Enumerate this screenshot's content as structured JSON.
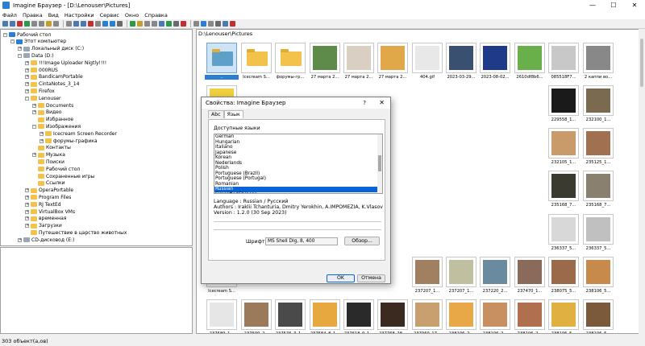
{
  "window": {
    "title": "Imagine Браузер - [D:\\Lenouser\\Pictures]",
    "buttons": [
      "—",
      "☐",
      "✕"
    ]
  },
  "menu": [
    "Файл",
    "Правка",
    "Вид",
    "Настройки",
    "Сервис",
    "Окно",
    "Справка"
  ],
  "tree": [
    {
      "label": "Рабочий стол",
      "level": 0,
      "icon": "desktop-icon",
      "exp": "–"
    },
    {
      "label": "Этот компьютер",
      "level": 1,
      "icon": "computer-icon",
      "exp": "–"
    },
    {
      "label": "Локальный диск (C:)",
      "level": 2,
      "icon": "drive-icon",
      "exp": "+"
    },
    {
      "label": "Data (D:)",
      "level": 2,
      "icon": "drive-icon",
      "exp": "–"
    },
    {
      "label": "!!!Image Uploader Nigtly!!!!",
      "level": 3,
      "icon": "folder-icon",
      "exp": "+"
    },
    {
      "label": "000RUS",
      "level": 3,
      "icon": "folder-icon",
      "exp": "+"
    },
    {
      "label": "BandicamPortable",
      "level": 3,
      "icon": "folder-icon",
      "exp": "+"
    },
    {
      "label": "CintaNotes_3_14",
      "level": 3,
      "icon": "folder-icon",
      "exp": "+"
    },
    {
      "label": "Firefox",
      "level": 3,
      "icon": "folder-icon",
      "exp": "+"
    },
    {
      "label": "Lenouser",
      "level": 3,
      "icon": "folder-icon",
      "exp": "–"
    },
    {
      "label": "Documents",
      "level": 4,
      "icon": "folder-icon",
      "exp": "+"
    },
    {
      "label": "Видео",
      "level": 4,
      "icon": "folder-icon",
      "exp": "+"
    },
    {
      "label": "Избранное",
      "level": 4,
      "icon": "folder-icon",
      "exp": ""
    },
    {
      "label": "Изображения",
      "level": 4,
      "icon": "folder-icon",
      "exp": "–"
    },
    {
      "label": "Icecream Screen Recorder",
      "level": 5,
      "icon": "folder-icon",
      "exp": "+"
    },
    {
      "label": "форумы-графика",
      "level": 5,
      "icon": "folder-icon",
      "exp": "+"
    },
    {
      "label": "Контакты",
      "level": 4,
      "icon": "folder-icon",
      "exp": ""
    },
    {
      "label": "Музыка",
      "level": 4,
      "icon": "folder-icon",
      "exp": "+"
    },
    {
      "label": "Поиски",
      "level": 4,
      "icon": "folder-icon",
      "exp": ""
    },
    {
      "label": "Рабочий стол",
      "level": 4,
      "icon": "folder-icon",
      "exp": ""
    },
    {
      "label": "Сохраненные игры",
      "level": 4,
      "icon": "folder-icon",
      "exp": ""
    },
    {
      "label": "Ссылки",
      "level": 4,
      "icon": "folder-icon",
      "exp": ""
    },
    {
      "label": "OperaPortable",
      "level": 3,
      "icon": "folder-icon",
      "exp": "+"
    },
    {
      "label": "Program Files",
      "level": 3,
      "icon": "folder-icon",
      "exp": "+"
    },
    {
      "label": "RJ TextEd",
      "level": 3,
      "icon": "folder-icon",
      "exp": "+"
    },
    {
      "label": "VirtualBox VMs",
      "level": 3,
      "icon": "folder-icon",
      "exp": "+"
    },
    {
      "label": "временная",
      "level": 3,
      "icon": "folder-icon",
      "exp": "+"
    },
    {
      "label": "Загрузки",
      "level": 3,
      "icon": "folder-icon",
      "exp": "+"
    },
    {
      "label": "Путешествие в царство животных",
      "level": 3,
      "icon": "folder-icon",
      "exp": ""
    },
    {
      "label": "CD-дисковод (E:)",
      "level": 2,
      "icon": "cdrom-icon",
      "exp": "+"
    }
  ],
  "path": "D:\\Lenouser\\Pictures",
  "thumbs": [
    {
      "cap": "..",
      "c": "#5fa0c8",
      "t": "up",
      "sel": true
    },
    {
      "cap": "Icecream S...",
      "c": "#f2c24a",
      "t": "folder"
    },
    {
      "cap": "форумы-гр...",
      "c": "#f2c24a",
      "t": "folder"
    },
    {
      "cap": "27 марта 2...",
      "c": "#5e8a4a"
    },
    {
      "cap": "27 марта 2...",
      "c": "#d9cfc2"
    },
    {
      "cap": "27 марта 2...",
      "c": "#e0a848"
    },
    {
      "cap": "404.gif",
      "c": "#e8e8e8"
    },
    {
      "cap": "2023-03-29...",
      "c": "#3a5070"
    },
    {
      "cap": "2023-08-02...",
      "c": "#203a8a"
    },
    {
      "cap": "2610df8b6...",
      "c": "#6ab04a"
    },
    {
      "cap": "085518F7...",
      "c": "#c8c8c8"
    },
    {
      "cap": "2 каппи во...",
      "c": "#888"
    },
    {
      "cap": "229558_1...",
      "c": "#1a1a1a"
    },
    {
      "cap": "232100_1...",
      "c": "#7a6a50"
    },
    {
      "cap": "232105_1...",
      "c": "#c99a6a"
    },
    {
      "cap": "235125_1...",
      "c": "#a07050"
    },
    {
      "cap": "235168_7...",
      "c": "#3a3a30"
    },
    {
      "cap": "235168_7...",
      "c": "#8a8070"
    },
    {
      "cap": "236337_5...",
      "c": "#d8d8d8"
    },
    {
      "cap": "236337_5...",
      "c": "#c0c0c0"
    },
    {
      "cap": "238075_5...",
      "c": "#9a6a4a"
    },
    {
      "cap": "238106_5...",
      "c": "#c88a4a"
    },
    {
      "cap": "238106_5...",
      "c": "#e0b040"
    },
    {
      "cap": "238106_5...",
      "c": "#7a5a3a"
    },
    {
      "cap": "237207_1...",
      "c": "#a08060"
    },
    {
      "cap": "237207_1...",
      "c": "#c0c0a0"
    },
    {
      "cap": "237220_2...",
      "c": "#6a8aa0"
    },
    {
      "cap": "237470_1...",
      "c": "#8a6a5a"
    },
    {
      "cap": "237589_1...",
      "c": "#e6e6e6"
    },
    {
      "cap": "237500_2...",
      "c": "#9a7a5a"
    },
    {
      "cap": "237576_3_1...",
      "c": "#4a4a4a"
    },
    {
      "cap": "237584_8_1...",
      "c": "#e8a840"
    },
    {
      "cap": "237618_9_1...",
      "c": "#2a2a2a"
    },
    {
      "cap": "237768_28...",
      "c": "#3a2a20"
    },
    {
      "cap": "237969_17...",
      "c": "#c8a070"
    },
    {
      "cap": "238106_2...",
      "c": "#e8a848"
    },
    {
      "cap": "238106_2...",
      "c": "#c89060"
    },
    {
      "cap": "238106_2...",
      "c": "#b07050"
    },
    {
      "cap": "238106_2...",
      "c": "#f0d040"
    },
    {
      "cap": "238106_5...",
      "c": "#a88060"
    },
    {
      "cap": "238106_5...",
      "c": "#7a6a5a"
    }
  ],
  "status": "303 объект(а,ов)",
  "dialog": {
    "title": "Свойства: Imagine Браузер",
    "help": "?",
    "close": "✕",
    "tab_abc": "Abc",
    "tab_lang": "Язык",
    "available_label": "Доступные языки",
    "languages": [
      "German",
      "Hungarian",
      "Italiano",
      "Japanese",
      "Korean",
      "Nederlands",
      "Polish",
      "Portuguese (Brazil)",
      "Portuguese (Portugal)",
      "Romanian",
      "Russian",
      "SimplifiedChinese"
    ],
    "selected": "Russian",
    "info1": "Language : Russian / Русский",
    "info2": "Authors : Iraklii Tchanturia, Dmitry Yerokhin, A.IMPOMEZIA, K.Vlasov, Mikhail Rybakov, i",
    "info3": "Version : 1.2.0 (30 Sep 2023)",
    "font_label": "Шрифт",
    "font_value": "MS Shell Dlg, 8, 400",
    "browse": "Обзор...",
    "ok": "OK",
    "cancel": "Отмена"
  }
}
